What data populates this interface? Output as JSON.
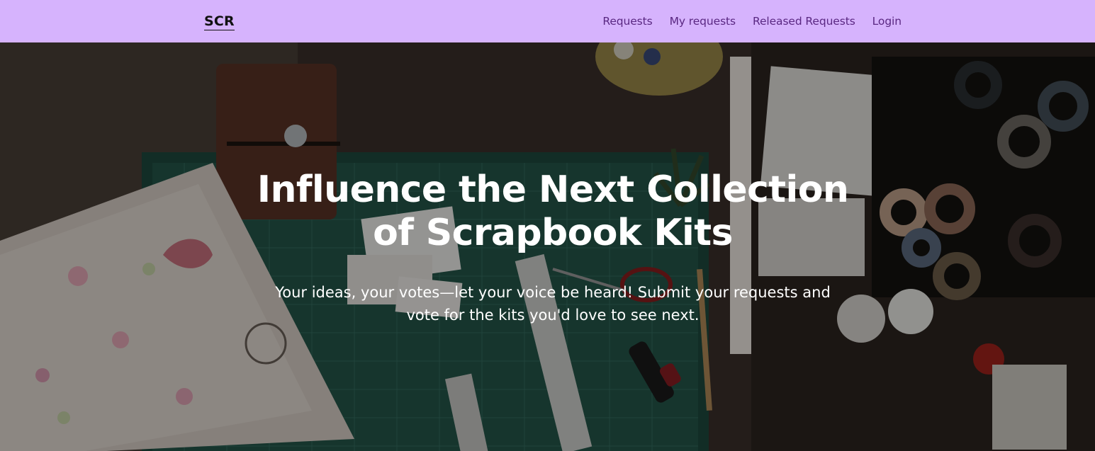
{
  "nav": {
    "brand": "SCR",
    "links": [
      "Requests",
      "My requests",
      "Released Requests",
      "Login"
    ]
  },
  "hero": {
    "title_line1": "Influence the Next Collection",
    "title_line2": "of Scrapbook Kits",
    "subtitle_line1": "Your ideas, your votes—let your voice be heard! Submit your requests and",
    "subtitle_line2": "vote for the kits you'd love to see next."
  },
  "colors": {
    "navbar_bg": "#d6b3fd",
    "nav_link": "#5a2882",
    "hero_text": "#ffffff"
  }
}
